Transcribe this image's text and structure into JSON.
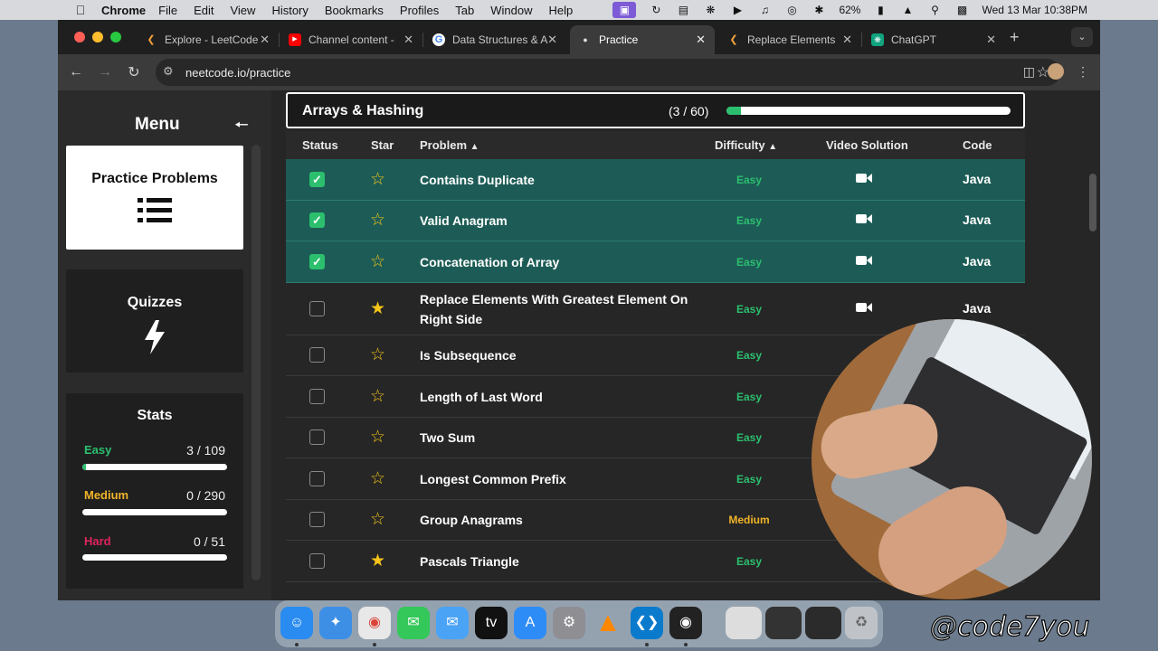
{
  "menubar": {
    "app": "Chrome",
    "items": [
      "File",
      "Edit",
      "View",
      "History",
      "Bookmarks",
      "Profiles",
      "Tab",
      "Window",
      "Help"
    ],
    "battery": "62%",
    "datetime": "Wed 13 Mar  10:38PM"
  },
  "tabs": [
    {
      "label": "Explore - LeetCode",
      "icon": "leetcode-icon"
    },
    {
      "label": "Channel content -",
      "icon": "youtube-icon"
    },
    {
      "label": "Data Structures & A",
      "icon": "google-icon"
    },
    {
      "label": "Practice",
      "icon": "neetcode-icon",
      "active": true
    },
    {
      "label": "Replace Elements",
      "icon": "leetcode-icon"
    },
    {
      "label": "ChatGPT",
      "icon": "chatgpt-icon"
    }
  ],
  "address": {
    "url": "neetcode.io/practice"
  },
  "sidebar": {
    "title": "Menu",
    "practice_label": "Practice Problems",
    "quizzes_label": "Quizzes",
    "stats_title": "Stats",
    "stats": [
      {
        "label": "Easy",
        "value": "3 / 109",
        "progress": 0.0275,
        "color": "#2bbf6e"
      },
      {
        "label": "Medium",
        "value": "0 / 290",
        "progress": 0,
        "color": "#f0b429"
      },
      {
        "label": "Hard",
        "value": "0 / 51",
        "progress": 0,
        "color": "#e0245e"
      }
    ]
  },
  "category": {
    "title": "Arrays & Hashing",
    "count": "(3 / 60)",
    "progress": 0.05
  },
  "table": {
    "headers": {
      "status": "Status",
      "star": "Star",
      "problem": "Problem",
      "difficulty": "Difficulty",
      "video": "Video Solution",
      "code": "Code"
    },
    "rows": [
      {
        "name": "Contains Duplicate",
        "difficulty": "Easy",
        "done": true,
        "starred": false,
        "video": true,
        "code": "Java"
      },
      {
        "name": "Valid Anagram",
        "difficulty": "Easy",
        "done": true,
        "starred": false,
        "video": true,
        "code": "Java"
      },
      {
        "name": "Concatenation of Array",
        "difficulty": "Easy",
        "done": true,
        "starred": false,
        "video": true,
        "code": "Java"
      },
      {
        "name": "Replace Elements With Greatest Element On Right Side",
        "difficulty": "Easy",
        "done": false,
        "starred": true,
        "video": true,
        "code": "Java"
      },
      {
        "name": "Is Subsequence",
        "difficulty": "Easy",
        "done": false,
        "starred": false,
        "video": false,
        "code": ""
      },
      {
        "name": "Length of Last Word",
        "difficulty": "Easy",
        "done": false,
        "starred": false,
        "video": false,
        "code": ""
      },
      {
        "name": "Two Sum",
        "difficulty": "Easy",
        "done": false,
        "starred": false,
        "video": false,
        "code": ""
      },
      {
        "name": "Longest Common Prefix",
        "difficulty": "Easy",
        "done": false,
        "starred": false,
        "video": false,
        "code": ""
      },
      {
        "name": "Group Anagrams",
        "difficulty": "Medium",
        "done": false,
        "starred": false,
        "video": false,
        "code": ""
      },
      {
        "name": "Pascals Triangle",
        "difficulty": "Easy",
        "done": false,
        "starred": true,
        "video": false,
        "code": ""
      }
    ]
  },
  "colors": {
    "easy": "#2bbf6e",
    "medium": "#f0b429",
    "hard": "#e0245e",
    "done_row": "#1d5c56"
  },
  "dock": [
    "finder-icon",
    "safari-icon",
    "chrome-icon",
    "messages-icon",
    "mail-icon",
    "appletv-icon",
    "appstore-icon",
    "settings-icon",
    "vlc-icon",
    "vscode-icon",
    "obs-icon",
    "trash-icon"
  ],
  "watermark": "@code7you"
}
